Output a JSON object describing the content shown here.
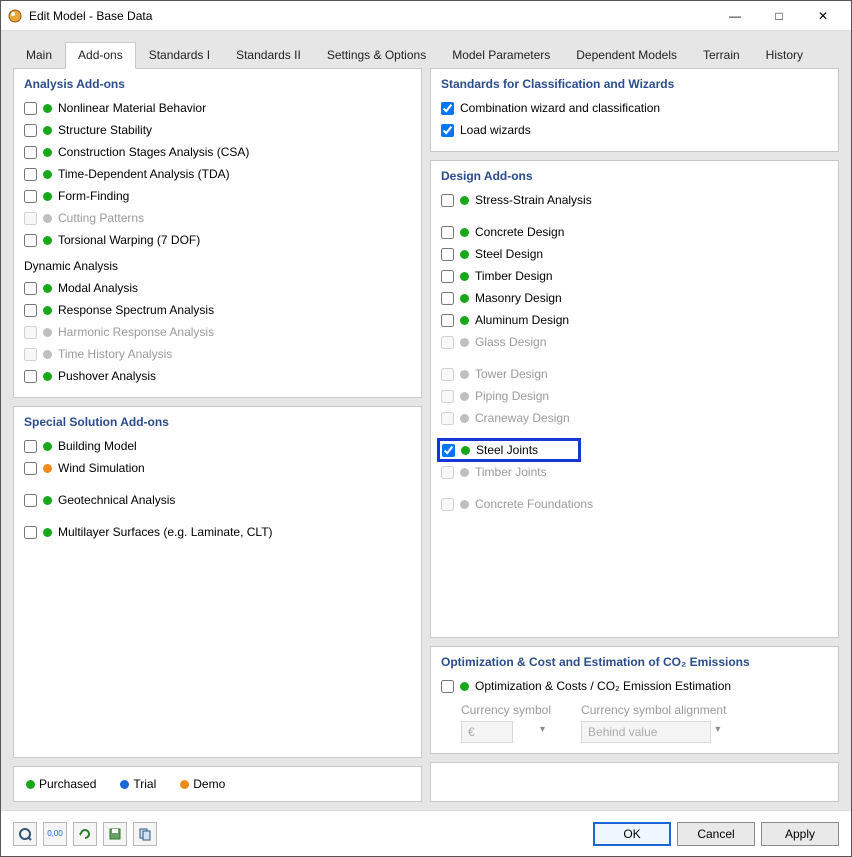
{
  "window": {
    "title": "Edit Model - Base Data"
  },
  "tabs": [
    "Main",
    "Add-ons",
    "Standards I",
    "Standards II",
    "Settings & Options",
    "Model Parameters",
    "Dependent Models",
    "Terrain",
    "History"
  ],
  "active_tab_index": 1,
  "left": {
    "analysis": {
      "title": "Analysis Add-ons",
      "items": [
        {
          "label": "Nonlinear Material Behavior",
          "checked": false,
          "dot": "green",
          "disabled": false
        },
        {
          "label": "Structure Stability",
          "checked": false,
          "dot": "green",
          "disabled": false
        },
        {
          "label": "Construction Stages Analysis (CSA)",
          "checked": false,
          "dot": "green",
          "disabled": false
        },
        {
          "label": "Time-Dependent Analysis (TDA)",
          "checked": false,
          "dot": "green",
          "disabled": false
        },
        {
          "label": "Form-Finding",
          "checked": false,
          "dot": "green",
          "disabled": false
        },
        {
          "label": "Cutting Patterns",
          "checked": false,
          "dot": "grey",
          "disabled": true
        },
        {
          "label": "Torsional Warping (7 DOF)",
          "checked": false,
          "dot": "green",
          "disabled": false
        }
      ],
      "dynamic_title": "Dynamic Analysis",
      "dynamic_items": [
        {
          "label": "Modal Analysis",
          "checked": false,
          "dot": "green",
          "disabled": false
        },
        {
          "label": "Response Spectrum Analysis",
          "checked": false,
          "dot": "green",
          "disabled": false
        },
        {
          "label": "Harmonic Response Analysis",
          "checked": false,
          "dot": "grey",
          "disabled": true
        },
        {
          "label": "Time History Analysis",
          "checked": false,
          "dot": "grey",
          "disabled": true
        },
        {
          "label": "Pushover Analysis",
          "checked": false,
          "dot": "green",
          "disabled": false
        }
      ]
    },
    "special": {
      "title": "Special Solution Add-ons",
      "items": [
        {
          "label": "Building Model",
          "checked": false,
          "dot": "green",
          "disabled": false
        },
        {
          "label": "Wind Simulation",
          "checked": false,
          "dot": "orange",
          "disabled": false
        }
      ],
      "items2": [
        {
          "label": "Geotechnical Analysis",
          "checked": false,
          "dot": "green",
          "disabled": false
        }
      ],
      "items3": [
        {
          "label": "Multilayer Surfaces (e.g. Laminate, CLT)",
          "checked": false,
          "dot": "green",
          "disabled": false
        }
      ]
    }
  },
  "right": {
    "standards": {
      "title": "Standards for Classification and Wizards",
      "items": [
        {
          "label": "Combination wizard and classification",
          "checked": true
        },
        {
          "label": "Load wizards",
          "checked": true
        }
      ]
    },
    "design": {
      "title": "Design Add-ons",
      "group1": [
        {
          "label": "Stress-Strain Analysis",
          "checked": false,
          "dot": "green",
          "disabled": false
        }
      ],
      "group2": [
        {
          "label": "Concrete Design",
          "checked": false,
          "dot": "green",
          "disabled": false
        },
        {
          "label": "Steel Design",
          "checked": false,
          "dot": "green",
          "disabled": false
        },
        {
          "label": "Timber Design",
          "checked": false,
          "dot": "green",
          "disabled": false
        },
        {
          "label": "Masonry Design",
          "checked": false,
          "dot": "green",
          "disabled": false
        },
        {
          "label": "Aluminum Design",
          "checked": false,
          "dot": "green",
          "disabled": false
        },
        {
          "label": "Glass Design",
          "checked": false,
          "dot": "grey",
          "disabled": true
        }
      ],
      "group3": [
        {
          "label": "Tower Design",
          "checked": false,
          "dot": "grey",
          "disabled": true
        },
        {
          "label": "Piping Design",
          "checked": false,
          "dot": "grey",
          "disabled": true
        },
        {
          "label": "Craneway Design",
          "checked": false,
          "dot": "grey",
          "disabled": true
        }
      ],
      "group4": [
        {
          "label": "Steel Joints",
          "checked": true,
          "dot": "green",
          "disabled": false,
          "highlight": true
        },
        {
          "label": "Timber Joints",
          "checked": false,
          "dot": "grey",
          "disabled": true
        }
      ],
      "group5": [
        {
          "label": "Concrete Foundations",
          "checked": false,
          "dot": "grey",
          "disabled": true
        }
      ]
    },
    "optimization": {
      "title": "Optimization & Cost and Estimation of CO₂ Emissions",
      "item": {
        "label": "Optimization & Costs / CO₂ Emission Estimation",
        "checked": false,
        "dot": "green"
      },
      "currency_label": "Currency symbol",
      "currency_value": "€",
      "alignment_label": "Currency symbol alignment",
      "alignment_value": "Behind value"
    }
  },
  "legend": {
    "purchased": "Purchased",
    "trial": "Trial",
    "demo": "Demo"
  },
  "buttons": {
    "ok": "OK",
    "cancel": "Cancel",
    "apply": "Apply"
  }
}
